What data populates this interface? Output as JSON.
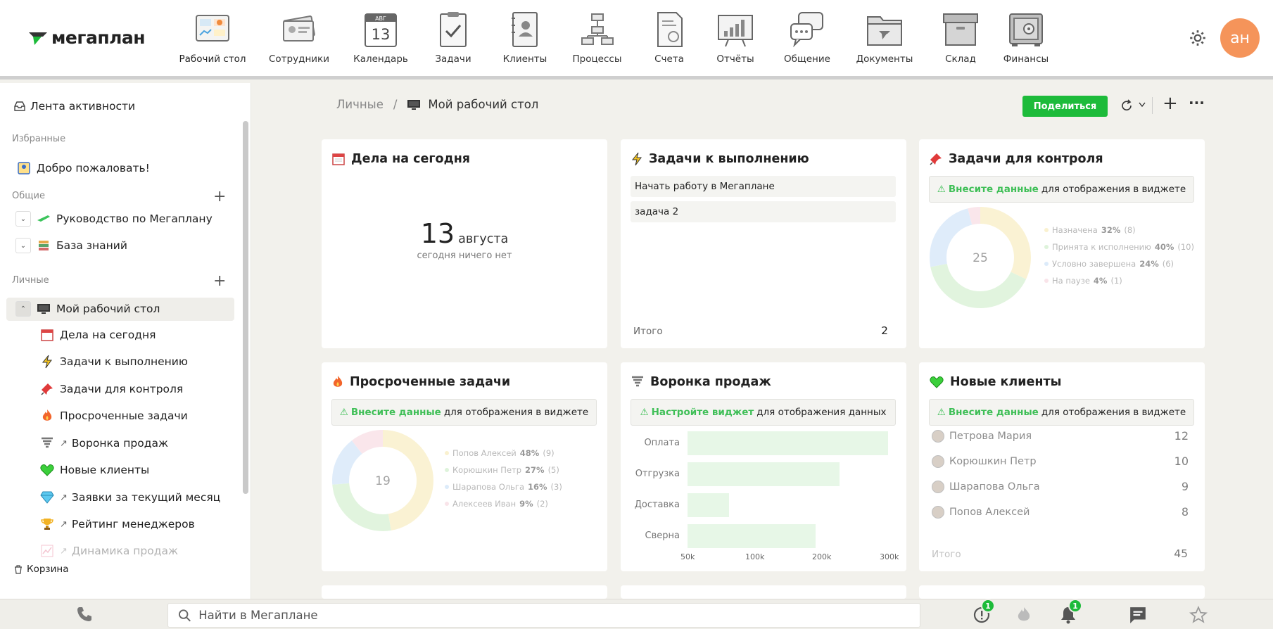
{
  "app": {
    "logo_text": "мегаплан"
  },
  "nav": [
    {
      "label": "Рабочий стол",
      "icon": "desktop-icon",
      "active": true
    },
    {
      "label": "Сотрудники",
      "icon": "employees-icon"
    },
    {
      "label": "Календарь",
      "icon": "calendar-icon"
    },
    {
      "label": "Задачи",
      "icon": "tasks-icon"
    },
    {
      "label": "Клиенты",
      "icon": "clients-icon"
    },
    {
      "label": "Процессы",
      "icon": "processes-icon"
    },
    {
      "label": "Счета",
      "icon": "invoices-icon"
    },
    {
      "label": "Отчёты",
      "icon": "reports-icon"
    },
    {
      "label": "Общение",
      "icon": "chat-icon"
    },
    {
      "label": "Документы",
      "icon": "documents-icon"
    },
    {
      "label": "Склад",
      "icon": "warehouse-icon"
    },
    {
      "label": "Финансы",
      "icon": "finance-icon"
    }
  ],
  "calendar_icon": {
    "month": "АВГ",
    "day": "13"
  },
  "user": {
    "initials": "ан"
  },
  "sidebar": {
    "feed": "Лента активности",
    "favorites_title": "Избранные",
    "favorites": [
      {
        "label": "Добро пожаловать!"
      }
    ],
    "common_title": "Общие",
    "common": [
      {
        "label": "Руководство по Мегаплану"
      },
      {
        "label": "База знаний"
      }
    ],
    "personal_title": "Личные",
    "personal_root": "Мой рабочий стол",
    "personal": [
      {
        "label": "Дела на сегодня"
      },
      {
        "label": "Задачи к выполнению"
      },
      {
        "label": "Задачи для контроля"
      },
      {
        "label": "Просроченные задачи"
      },
      {
        "label": "Воронка продаж"
      },
      {
        "label": "Новые клиенты"
      },
      {
        "label": "Заявки за текущий месяц"
      },
      {
        "label": "Рейтинг менеджеров"
      },
      {
        "label": "Динамика продаж"
      }
    ],
    "trash": "Корзина"
  },
  "breadcrumb": {
    "parent": "Личные",
    "separator": "/",
    "current": "Мой рабочий стол"
  },
  "toolbar": {
    "share_label": "Поделиться",
    "add": "+",
    "more": "···"
  },
  "widgets": {
    "today": {
      "title": "Дела на сегодня",
      "day": "13",
      "month": "августа",
      "empty": "сегодня ничего нет"
    },
    "todo": {
      "title": "Задачи к выполнению",
      "items": [
        "Начать работу в Мегаплане",
        "задача 2"
      ],
      "total_label": "Итого",
      "total": "2"
    },
    "control": {
      "title": "Задачи для контроля",
      "warn_link": "Внесите данные",
      "warn_text": "для отображения в виджете",
      "center": "25",
      "legend": [
        {
          "name": "Назначена",
          "pct": "32%",
          "count": "(8)",
          "value": 8,
          "color": "#f7e9b0"
        },
        {
          "name": "Принята к исполнению",
          "pct": "40%",
          "count": "(10)",
          "value": 10,
          "color": "#c9ecc4"
        },
        {
          "name": "Условно завершена",
          "pct": "24%",
          "count": "(6)",
          "value": 6,
          "color": "#c6def7"
        },
        {
          "name": "На паузе",
          "pct": "4%",
          "count": "(1)",
          "value": 1,
          "color": "#f6d3dc"
        }
      ]
    },
    "overdue": {
      "title": "Просроченные задачи",
      "warn_link": "Внесите данные",
      "warn_text": "для отображения в виджете",
      "center": "19",
      "legend": [
        {
          "name": "Попов Алексей",
          "pct": "48%",
          "count": "(9)",
          "value": 9,
          "color": "#f7e9b0"
        },
        {
          "name": "Корюшкин Петр",
          "pct": "27%",
          "count": "(5)",
          "value": 5,
          "color": "#c9ecc4"
        },
        {
          "name": "Шарапова Ольга",
          "pct": "16%",
          "count": "(3)",
          "value": 3,
          "color": "#c6def7"
        },
        {
          "name": "Алексеев Иван",
          "pct": "9%",
          "count": "(2)",
          "value": 2,
          "color": "#f6d3dc"
        }
      ]
    },
    "funnel": {
      "title": "Воронка продаж",
      "warn_link": "Настройте виджет",
      "warn_text": "для отображения данных",
      "chart_data": {
        "type": "bar",
        "orientation": "horizontal",
        "categories": [
          "Оплата",
          "Отгрузка",
          "Доставка",
          "Сверна"
        ],
        "values": [
          290000,
          220000,
          60000,
          185000
        ],
        "xticks": [
          "50k",
          "100k",
          "200k",
          "300k"
        ]
      }
    },
    "clients": {
      "title": "Новые клиенты",
      "warn_link": "Внесите данные",
      "warn_text": "для отображения в виджете",
      "rows": [
        {
          "name": "Петрова Мария",
          "value": "12"
        },
        {
          "name": "Корюшкин Петр",
          "value": "10"
        },
        {
          "name": "Шарапова Ольга",
          "value": "9"
        },
        {
          "name": "Попов Алексей",
          "value": "8"
        }
      ],
      "total_label": "Итого",
      "total": "45"
    }
  },
  "bottom": {
    "search_placeholder": "Найти в Мегаплане",
    "alerts_badge": "1",
    "notifications_badge": "1"
  },
  "colors": {
    "accent": "#1dbb3a",
    "avatar": "#f5945a",
    "highlight": "#3fbf57"
  }
}
